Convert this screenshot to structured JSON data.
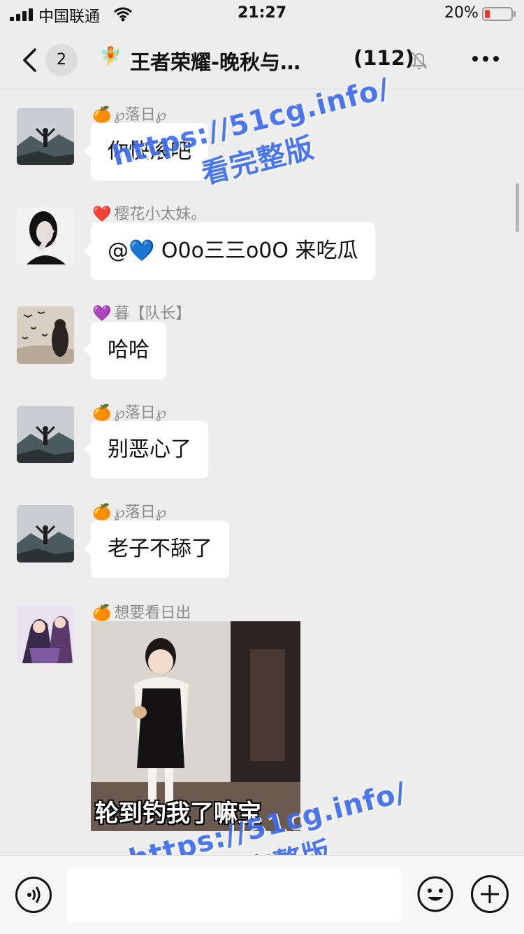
{
  "status_bar": {
    "carrier": "中国联通",
    "time": "21:27",
    "battery_percent": "20%",
    "battery_level": 0.2
  },
  "nav": {
    "unread_count": "2",
    "title_icon": "🧚",
    "title": "王者荣耀-晚秋与…",
    "member_count": "(112)"
  },
  "messages": [
    {
      "sender_emoji": "🍊",
      "sender": "℘落日℘",
      "text": "你快滚吧",
      "avatar": "mountain-person-avatar"
    },
    {
      "sender_emoji": "❤️",
      "sender": "樱花小太妹。",
      "text_prefix": "@",
      "text_emoji": "💙",
      "text": " O0o三三o0O 来吃瓜",
      "avatar": "girl-covering-face-avatar"
    },
    {
      "sender_emoji": "💜",
      "sender": "暮【队长】",
      "text": "哈哈",
      "avatar": "birds-girl-avatar"
    },
    {
      "sender_emoji": "🍊",
      "sender": "℘落日℘",
      "text": "别恶心了",
      "avatar": "mountain-person-avatar"
    },
    {
      "sender_emoji": "🍊",
      "sender": "℘落日℘",
      "text": "老子不舔了",
      "avatar": "mountain-person-avatar"
    },
    {
      "sender_emoji": "🍊",
      "sender": "想要看日出",
      "sticker_caption": "轮到钓我了嘛宝",
      "avatar": "anime-couple-avatar"
    }
  ],
  "watermarks": [
    {
      "line1": "https://51cg.info/",
      "line2": "看完整版"
    },
    {
      "line1": "https://51cg.info/",
      "line2": "看完整版"
    }
  ],
  "input": {
    "placeholder": ""
  },
  "colors": {
    "background": "#ededed",
    "bubble": "#ffffff",
    "watermark": "#3d6cf0",
    "battery_low": "#e23b3b"
  }
}
